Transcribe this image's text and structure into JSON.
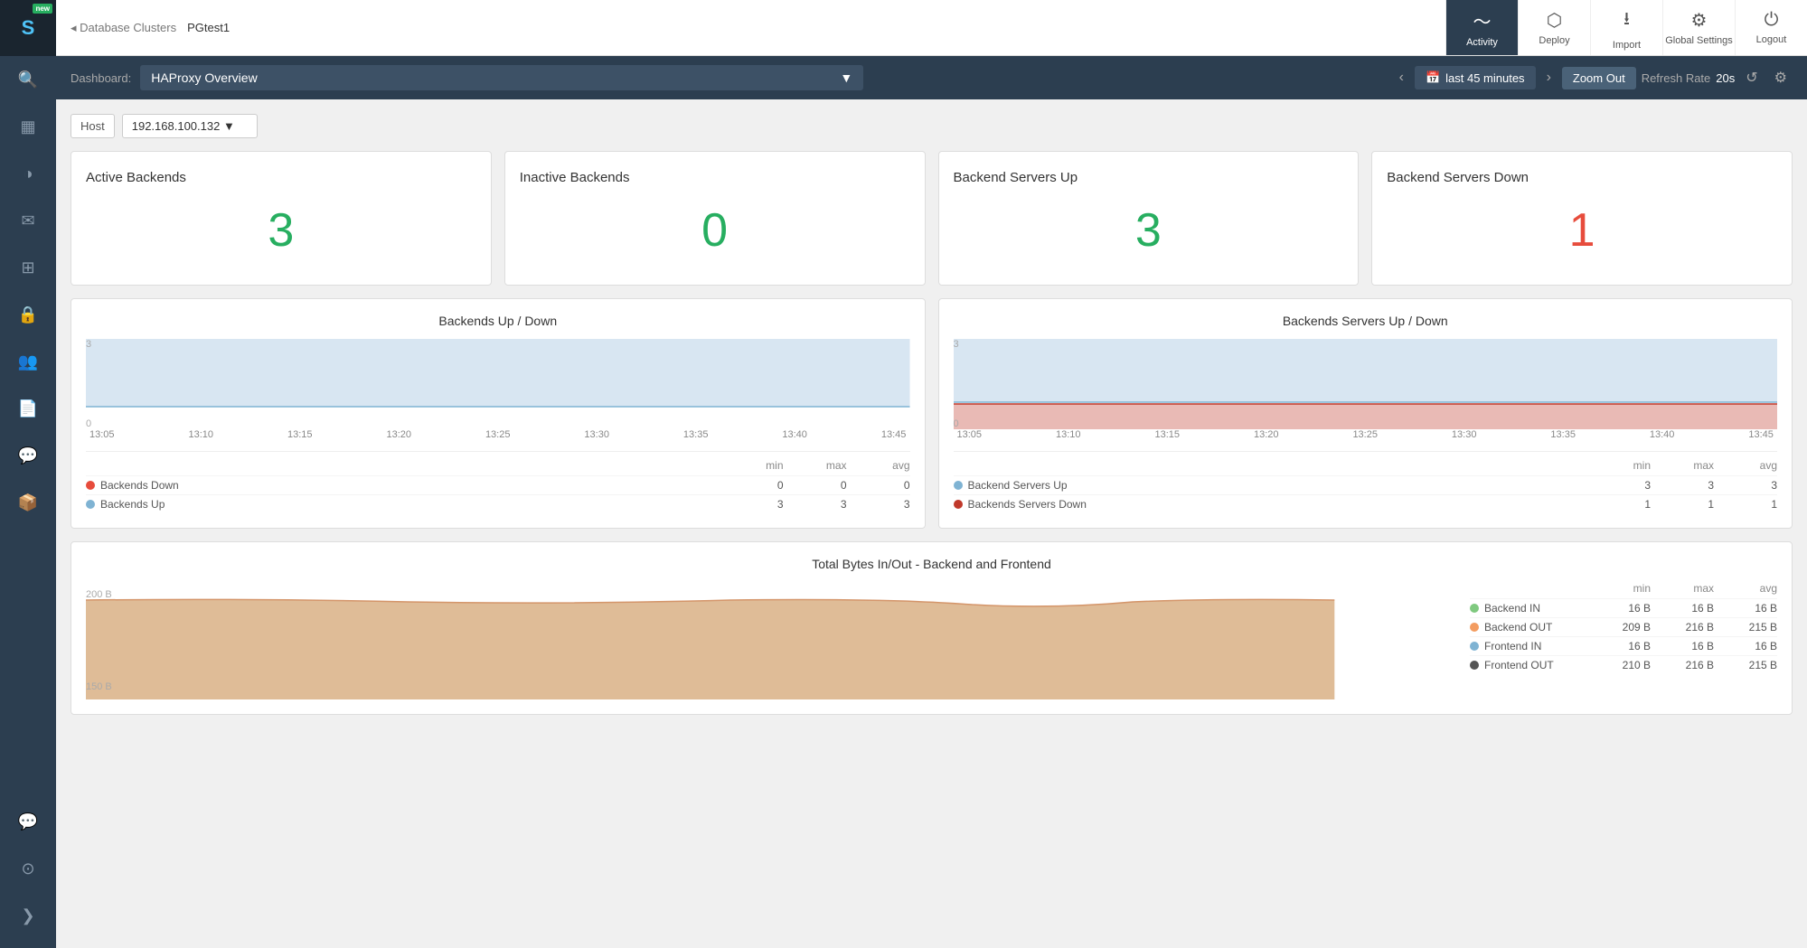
{
  "sidebar": {
    "logo_text": "S",
    "new_badge": "new",
    "icons": [
      {
        "name": "search-icon",
        "glyph": "🔍"
      },
      {
        "name": "dashboard-icon",
        "glyph": "▦"
      },
      {
        "name": "chart-icon",
        "glyph": "◑"
      },
      {
        "name": "mail-icon",
        "glyph": "✉"
      },
      {
        "name": "puzzle-icon",
        "glyph": "⊞"
      },
      {
        "name": "lock-icon",
        "glyph": "🔒"
      },
      {
        "name": "users-icon",
        "glyph": "👥"
      },
      {
        "name": "file-icon",
        "glyph": "📄"
      },
      {
        "name": "chat-icon",
        "glyph": "💬"
      },
      {
        "name": "box-icon",
        "glyph": "📦"
      }
    ],
    "bottom_icons": [
      {
        "name": "comment-icon",
        "glyph": "💬"
      },
      {
        "name": "toggle-icon",
        "glyph": "⊙"
      },
      {
        "name": "arrow-icon",
        "glyph": "❯"
      }
    ]
  },
  "topnav": {
    "breadcrumb_parent": "Database Clusters",
    "breadcrumb_current": "PGtest1",
    "actions": [
      {
        "id": "activity",
        "label": "Activity",
        "icon": "〜",
        "active": true
      },
      {
        "id": "deploy",
        "label": "Deploy",
        "icon": "⬡"
      },
      {
        "id": "import",
        "label": "Import",
        "icon": "⭳"
      },
      {
        "id": "global-settings",
        "label": "Global Settings",
        "icon": "⚙"
      },
      {
        "id": "logout",
        "label": "Logout",
        "icon": "⏻"
      }
    ]
  },
  "dashboard_toolbar": {
    "label": "Dashboard:",
    "selected": "HAProxy Overview",
    "time_range": "last 45 minutes",
    "zoom_out": "Zoom Out",
    "refresh_label": "Refresh Rate",
    "refresh_rate": "20s"
  },
  "host_filter": {
    "label": "Host",
    "value": "192.168.100.132"
  },
  "stat_cards": [
    {
      "title": "Active Backends",
      "value": "3",
      "color": "green"
    },
    {
      "title": "Inactive Backends",
      "value": "0",
      "color": "green"
    },
    {
      "title": "Backend Servers Up",
      "value": "3",
      "color": "green"
    },
    {
      "title": "Backend Servers Down",
      "value": "1",
      "color": "red"
    }
  ],
  "chart_backends_updown": {
    "title": "Backends Up / Down",
    "x_labels": [
      "13:05",
      "13:10",
      "13:15",
      "13:20",
      "13:25",
      "13:30",
      "13:35",
      "13:40",
      "13:45"
    ],
    "y_labels": [
      "3",
      "0"
    ],
    "legend_header": [
      "min",
      "max",
      "avg"
    ],
    "legend_rows": [
      {
        "name": "Backends Down",
        "color": "#e74c3c",
        "min": "0",
        "max": "0",
        "avg": "0"
      },
      {
        "name": "Backends Up",
        "color": "#7fb3d3",
        "min": "3",
        "max": "3",
        "avg": "3"
      }
    ]
  },
  "chart_servers_updown": {
    "title": "Backends Servers Up / Down",
    "x_labels": [
      "13:05",
      "13:10",
      "13:15",
      "13:20",
      "13:25",
      "13:30",
      "13:35",
      "13:40",
      "13:45"
    ],
    "y_labels": [
      "3",
      "0"
    ],
    "legend_header": [
      "min",
      "max",
      "avg"
    ],
    "legend_rows": [
      {
        "name": "Backend Servers Up",
        "color": "#7fb3d3",
        "min": "3",
        "max": "3",
        "avg": "3"
      },
      {
        "name": "Backends Servers Down",
        "color": "#c0392b",
        "min": "1",
        "max": "1",
        "avg": "1"
      }
    ]
  },
  "chart_bytes": {
    "title": "Total Bytes In/Out - Backend and Frontend",
    "legend_header": [
      "min",
      "max",
      "avg"
    ],
    "legend_rows": [
      {
        "name": "Backend IN",
        "color": "#7fc97f",
        "min": "16 B",
        "max": "16 B",
        "avg": "16 B"
      },
      {
        "name": "Backend OUT",
        "color": "#f39c60",
        "min": "209 B",
        "max": "216 B",
        "avg": "215 B"
      },
      {
        "name": "Frontend IN",
        "color": "#7fb3d3",
        "min": "16 B",
        "max": "16 B",
        "avg": "16 B"
      },
      {
        "name": "Frontend OUT",
        "color": "#555",
        "min": "210 B",
        "max": "216 B",
        "avg": "215 B"
      }
    ],
    "y_labels": [
      "200 B",
      "150 B"
    ]
  }
}
